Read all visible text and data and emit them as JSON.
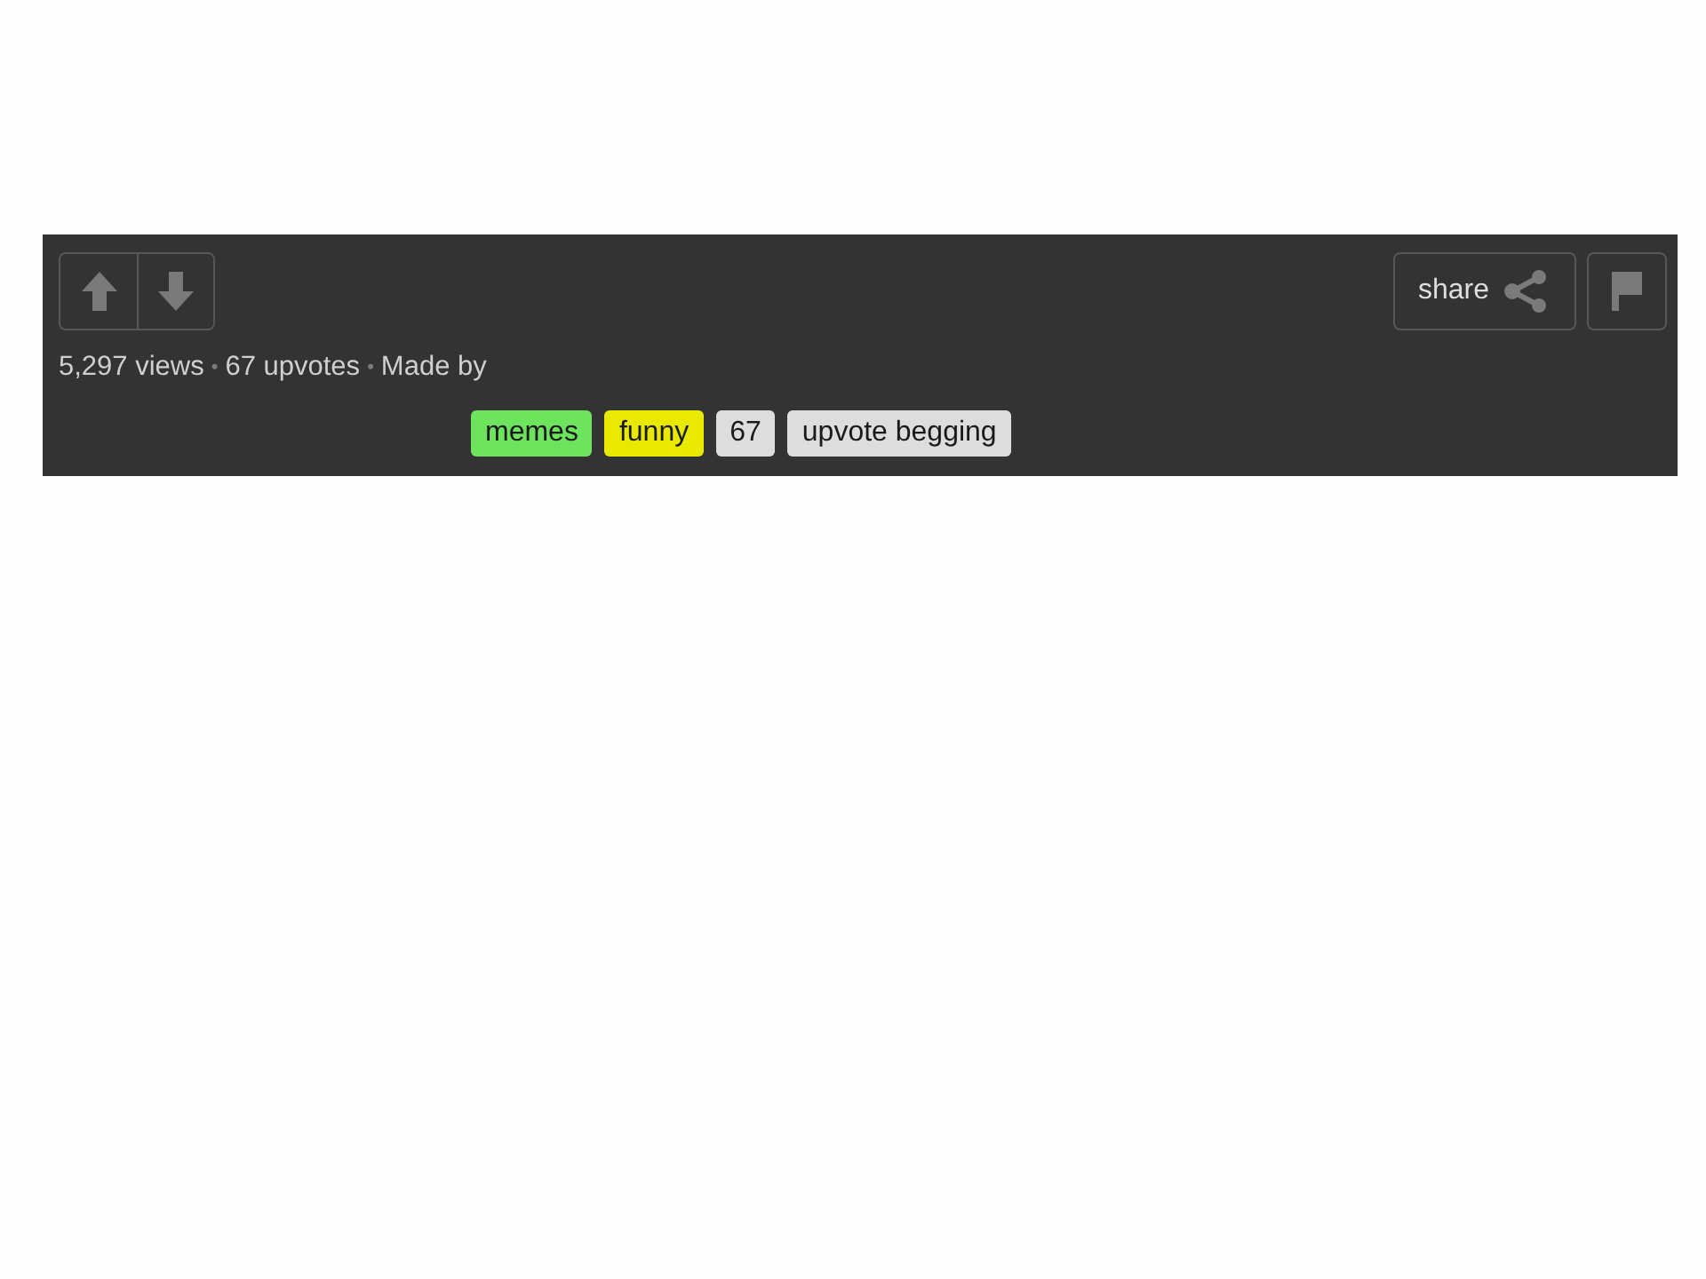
{
  "votes": {
    "buttons": [
      {
        "kind": "up"
      },
      {
        "kind": "down"
      }
    ]
  },
  "actions": {
    "share": {
      "label": "share"
    },
    "flag": {
      "kind": "flag"
    }
  },
  "stats": [
    {
      "kind": "text",
      "text": "5,297 views"
    },
    {
      "kind": "separator",
      "text": "•"
    },
    {
      "kind": "text",
      "text": "67 upvotes"
    },
    {
      "kind": "separator",
      "text": "•"
    },
    {
      "kind": "text",
      "text": "Made by"
    }
  ],
  "tags": [
    {
      "label": "memes",
      "color": "#6ee35e"
    },
    {
      "label": "funny",
      "color": "#e9e900"
    },
    {
      "label": "67",
      "color": "#dddddd"
    },
    {
      "label": "upvote begging",
      "color": "#dddddd"
    }
  ]
}
